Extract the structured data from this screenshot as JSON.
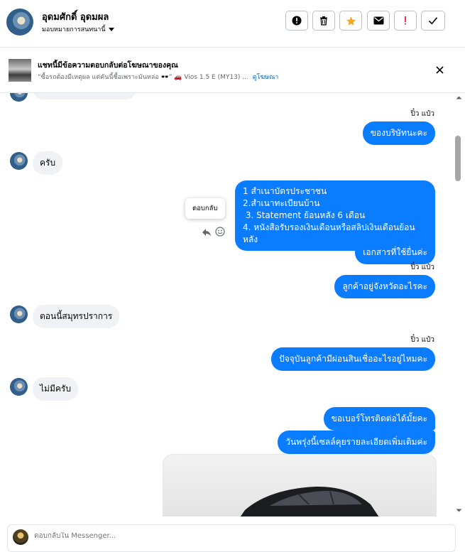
{
  "header": {
    "name": "อุดมศักดิ์ อุดมผล",
    "assign_label": "มอบหมายการสนทนานี้",
    "buttons": [
      {
        "icon": "exclamation-circle-icon"
      },
      {
        "icon": "trash-icon"
      },
      {
        "icon": "star-icon",
        "color": "#f5a623"
      },
      {
        "icon": "mail-icon"
      },
      {
        "icon": "exclamation-icon",
        "color": "#e41e3f"
      },
      {
        "icon": "check-icon"
      }
    ]
  },
  "ad": {
    "title": "แชทนี้มีข้อความตอบกลับต่อโฆษณาของคุณ",
    "subtitle": "“ซื้อรถต้องมีเหตุผล แต่คันนี้ซื้อเพราะมันหล่อ 🕶️” 🚗 Vios 1.5 E (MY13) ...",
    "link": "ดูโฆษณา"
  },
  "messages": {
    "seen_1": "ปิ๋ว แป๋ว",
    "out_1": "ของบริษัทนะคะ",
    "in_1": "ครับ",
    "out_2_lines": [
      "1 สำเนาบัตรประชาชน",
      "2.สำเนาทะเบียนบ้าน",
      " 3. Statement ย้อนหลัง 6 เดือน",
      "4. หนังสือรับรองเงินเดือนหรือสลิปเงินเดือนย้อนหลัง"
    ],
    "out_3": "เอกสารที่ใช้ยื่นค่ะ",
    "seen_2": "ปิ๋ว แป๋ว",
    "out_4": "ลูกค้าอยู่จังหวัดอะไรคะ",
    "in_2": "ตอนนี้สมุทรปราการ",
    "seen_3": "ปิ๋ว แป๋ว",
    "out_5": "ปัจจุบันลูกค้ามีผ่อนสินเชื่ออะไรอยู่ไหมคะ",
    "in_3": "ไม่มีครับ",
    "out_6": "ขอเบอร์โทรติดต่อได้มั้ยคะ",
    "out_7": "วันพรุ่งนี้เซลล์คุยรายละเอียดเพิ่มเติมค่ะ",
    "tooltip": "ตอบกลับ"
  },
  "composer": {
    "placeholder": "ตอบกลับใน Messenger..."
  },
  "colors": {
    "outgoing": "#0a7cff",
    "incoming": "#f0f2f5",
    "link": "#0064d1"
  }
}
